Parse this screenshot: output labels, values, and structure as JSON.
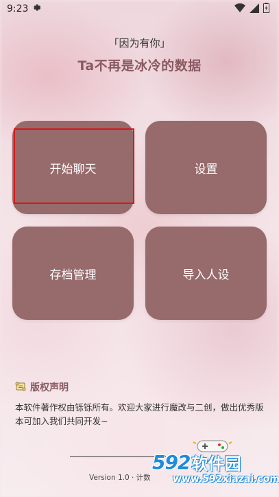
{
  "status": {
    "time": "9:23",
    "icons": [
      "gear-icon",
      "wifi-icon",
      "signal-icon",
      "battery-icon"
    ]
  },
  "header": {
    "subtitle": "「因为有你」",
    "title": "Ta不再是冰冷的数据"
  },
  "menu": {
    "start_chat": "开始聊天",
    "settings": "设置",
    "archive_manage": "存档管理",
    "import_persona": "导入人设"
  },
  "copyright": {
    "title": "版权声明",
    "body": "本软件著作权由铄铄所有。欢迎大家进行魔改与二创，做出优秀版本可加入我们共同开发~"
  },
  "footer": {
    "version": "Version 1.0 · 计数"
  },
  "watermark": {
    "number": "592",
    "name": "软件园",
    "url": "www.592xiazai.com"
  },
  "colors": {
    "card": "#976a6c",
    "title": "#8a5a60",
    "highlight": "#d11a1a",
    "watermark": "#1e8cdc"
  }
}
